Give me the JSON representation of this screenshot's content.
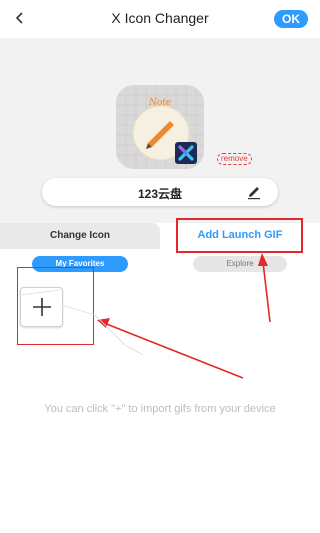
{
  "header": {
    "title": "X Icon Changer",
    "ok_label": "OK"
  },
  "preview": {
    "app_name": "123云盘",
    "remove_label": "remove",
    "note_label": "Note"
  },
  "tabs": {
    "change_icon": "Change Icon",
    "add_launch_gif": "Add Launch GIF"
  },
  "subtabs": {
    "my_favorites": "My Favorites",
    "explore": "Explore"
  },
  "hint": "You can click \"+\" to import gifs from your device",
  "colors": {
    "accent": "#2e9bff",
    "annotation": "#e5272b"
  },
  "icons": [
    "back-arrow-icon",
    "pencil-edit-icon",
    "app-icon",
    "x-badge-icon",
    "plus-icon"
  ]
}
